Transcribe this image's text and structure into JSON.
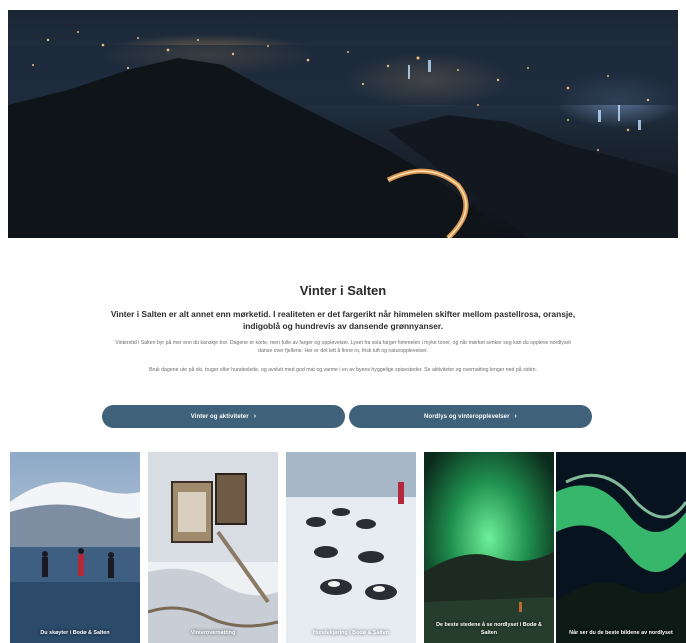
{
  "page": {
    "title": "Vinter i Salten",
    "lead": "Vinter i Salten er alt annet enn mørketid. I realiteten er det fargerikt når himmelen skifter mellom pastellrosa, oransje, indigoblå og hundrevis av dansende grønnyanser.",
    "body_1": "Vinterstid i Salten byr på mer enn du kanskje tror. Dagene er korte, men fulle av farger og opplevelser. Lyset fra sola farger himmelen i myke toner, og når mørket senker seg kan du oppleve nordlyset danse over fjellene. Her er det lett å finne ro, frisk luft og naturopplevelser.",
    "body_2": "Bruk dagene ute på ski, truger eller hundeslede, og avslutt med god mat og varme i en av byens hyggelige spisesteder. Se aktiviteter og overnatting lenger ned på siden.",
    "buttons": {
      "left": "Vinter og aktiviteter",
      "right": "Nordlys og vinteropplevelser",
      "chevron": "›"
    }
  },
  "cards": [
    {
      "caption": "Du skøyter i Bodø & Salten"
    },
    {
      "caption": "Vinterovernatting"
    },
    {
      "caption": "Hundekjøring i Bodø & Salten"
    },
    {
      "caption": "De beste stedene å se nordlyset i Bodø & Salten"
    },
    {
      "caption": "Når ser du de beste bildene av nordlyset"
    }
  ],
  "colors": {
    "button": "#3f6179",
    "aurora": "#3fd37a",
    "sky": "#1a2634"
  }
}
